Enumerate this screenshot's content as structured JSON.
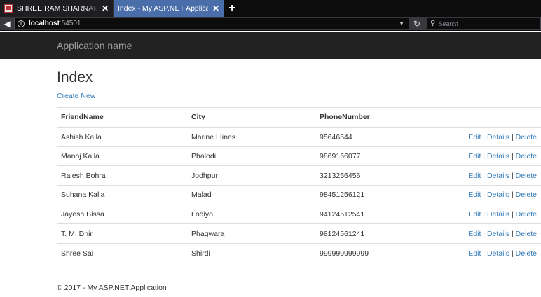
{
  "browser": {
    "tabs": [
      {
        "title": "SHREE RAM SHARNAM - Inte",
        "active": false
      },
      {
        "title": "Index - My ASP.NET Application",
        "active": true
      }
    ],
    "url_host": "localhost",
    "url_port": ":54501",
    "search_placeholder": "Search"
  },
  "site": {
    "brand": "Application name",
    "page_title": "Index",
    "create_link": "Create New",
    "footer": "© 2017 - My ASP.NET Application"
  },
  "table": {
    "columns": [
      "FriendName",
      "City",
      "PhoneNumber"
    ],
    "action_labels": {
      "edit": "Edit",
      "details": "Details",
      "delete": "Delete",
      "separator": "|"
    },
    "rows": [
      {
        "name": "Ashish Kalla",
        "city": "Marine LIines",
        "phone": "95646544"
      },
      {
        "name": "Manoj Kalla",
        "city": "Phalodi",
        "phone": "9869166077"
      },
      {
        "name": "Rajesh Bohra",
        "city": "Jodhpur",
        "phone": "3213256456"
      },
      {
        "name": "Suhana Kalla",
        "city": "Malad",
        "phone": "98451256121"
      },
      {
        "name": "Jayesh Bissa",
        "city": "Lodiyo",
        "phone": "94124512541"
      },
      {
        "name": "T. M. Dhir",
        "city": "Phagwara",
        "phone": "98124561241"
      },
      {
        "name": "Shree Sai",
        "city": "Shirdi",
        "phone": "999999999999"
      }
    ]
  },
  "colors": {
    "link": "#337ab7",
    "navbar": "#222222",
    "active_tab": "#4a6ea9"
  }
}
